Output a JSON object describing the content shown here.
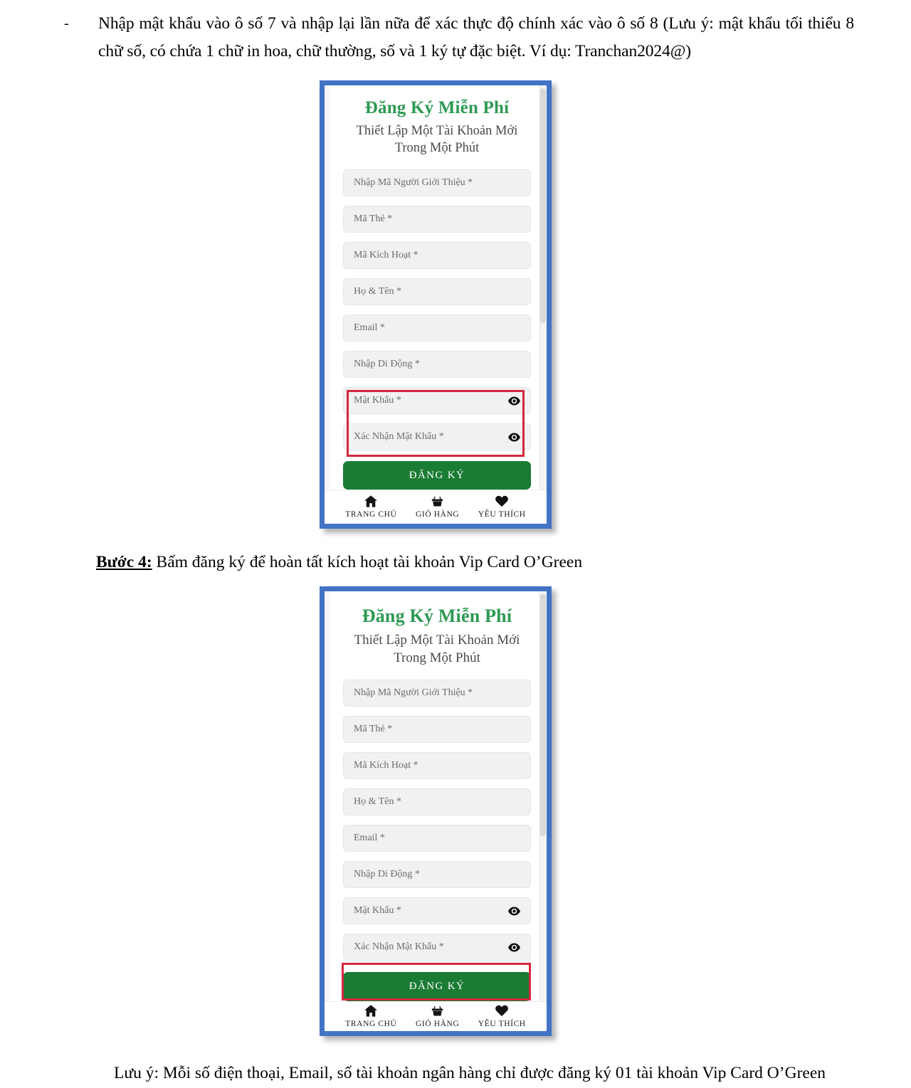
{
  "document": {
    "bullet_dash": "-",
    "bullet_text": "Nhập mật khẩu vào ô số 7 và nhập lại lần nữa để xác thực độ chính xác vào ô số 8 (Lưu ý: mật khẩu tối thiểu 8 chữ số, có chứa 1 chữ in hoa, chữ thường, số và 1 ký tự đặc biệt. Ví dụ: Tranchan2024@)",
    "step_label": "Bước 4:",
    "step_text": " Bấm đăng ký để hoàn tất kích hoạt tài khoản Vip Card O’Green",
    "footer_note": "Lưu ý: Mỗi số điện thoại, Email, số tài khoản ngân hàng chỉ được đăng ký 01 tài khoản Vip Card O’Green"
  },
  "colors": {
    "frame_blue": "#4273C5",
    "title_green": "#2E9A54",
    "button_green": "#1A7B33",
    "annotation_red": "#D4283F",
    "field_grey": "#f1f1f1"
  },
  "screen": {
    "title": "Đăng Ký Miễn Phí",
    "subtitle_line1": "Thiết Lập Một Tài Khoản Mới",
    "subtitle_line2": "Trong Một Phút",
    "fields": [
      {
        "placeholder": "Nhập Mã Người Giới Thiệu *",
        "name": "referral-code-field",
        "eye": false
      },
      {
        "placeholder": "Mã Thẻ *",
        "name": "card-code-field",
        "eye": false
      },
      {
        "placeholder": "Mã Kích Hoạt *",
        "name": "activation-code-field",
        "eye": false
      },
      {
        "placeholder": "Họ & Tên *",
        "name": "full-name-field",
        "eye": false
      },
      {
        "placeholder": "Email *",
        "name": "email-field",
        "eye": false
      },
      {
        "placeholder": "Nhập Di Động *",
        "name": "mobile-field",
        "eye": false
      },
      {
        "placeholder": "Mật Khẩu *",
        "name": "password-field",
        "eye": true
      },
      {
        "placeholder": "Xác Nhận Mật Khẩu *",
        "name": "confirm-password-field",
        "eye": true
      }
    ],
    "submit_label": "ĐĂNG KÝ",
    "nav": [
      {
        "icon": "home-icon",
        "label": "TRANG CHỦ"
      },
      {
        "icon": "basket-icon",
        "label": "GIỎ HÀNG"
      },
      {
        "icon": "heart-icon",
        "label": "YÊU THÍCH"
      }
    ]
  },
  "annotations": {
    "mockup1_highlight": "password-fields",
    "mockup2_highlight": "submit-button"
  }
}
